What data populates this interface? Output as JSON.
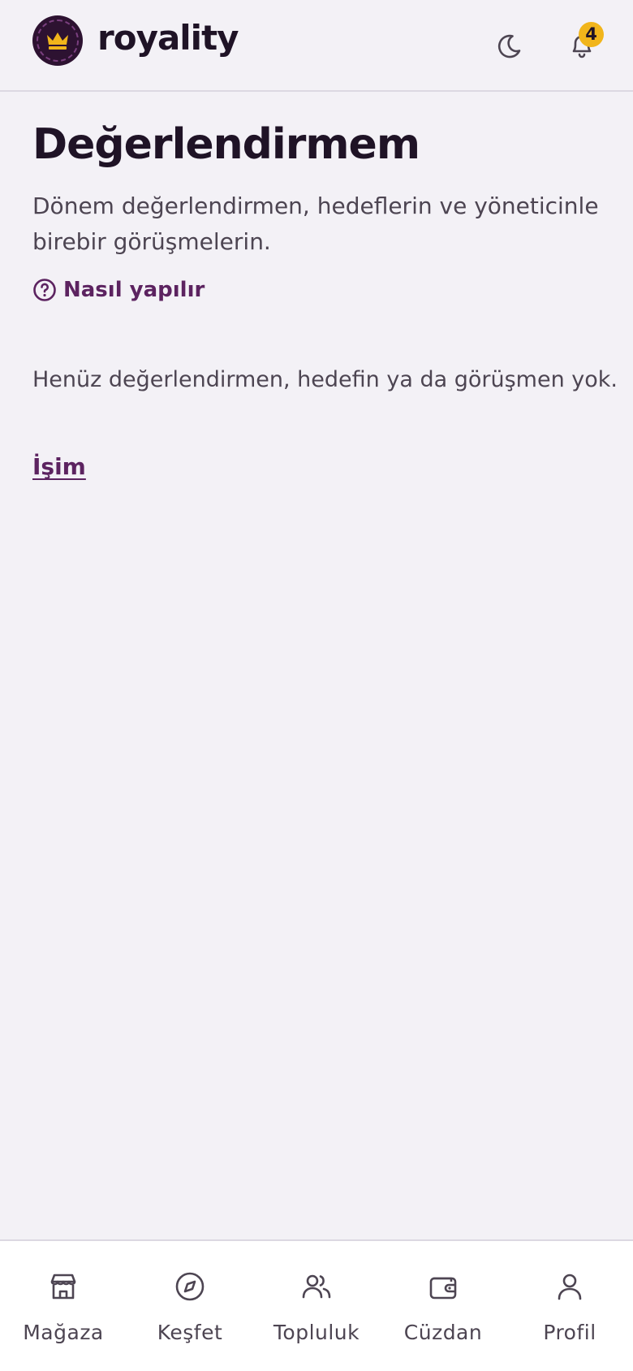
{
  "header": {
    "brand": "royality",
    "notification_count": "4",
    "icons": [
      "crown-logo-icon",
      "moon-icon",
      "bell-icon"
    ]
  },
  "main": {
    "title": "Değerlendirmem",
    "subtitle": "Dönem değerlendirmen, hedeflerin ve yöneticinle birebir görüşmelerin.",
    "howto_label": "Nasıl yapılır",
    "empty_text": "Henüz değerlendirmen, hedefin ya da görüşmen yok.",
    "work_link": "İşim"
  },
  "bottom_nav": {
    "items": [
      {
        "label": "Mağaza",
        "icon": "store-icon"
      },
      {
        "label": "Keşfet",
        "icon": "compass-icon"
      },
      {
        "label": "Topluluk",
        "icon": "users-icon"
      },
      {
        "label": "Cüzdan",
        "icon": "wallet-icon"
      },
      {
        "label": "Profil",
        "icon": "user-icon"
      }
    ]
  },
  "colors": {
    "background": "#f3f1f6",
    "accent": "#5c2360",
    "logo_bg": "#2d1231",
    "crown": "#f1b51b",
    "badge": "#f1b51b"
  }
}
